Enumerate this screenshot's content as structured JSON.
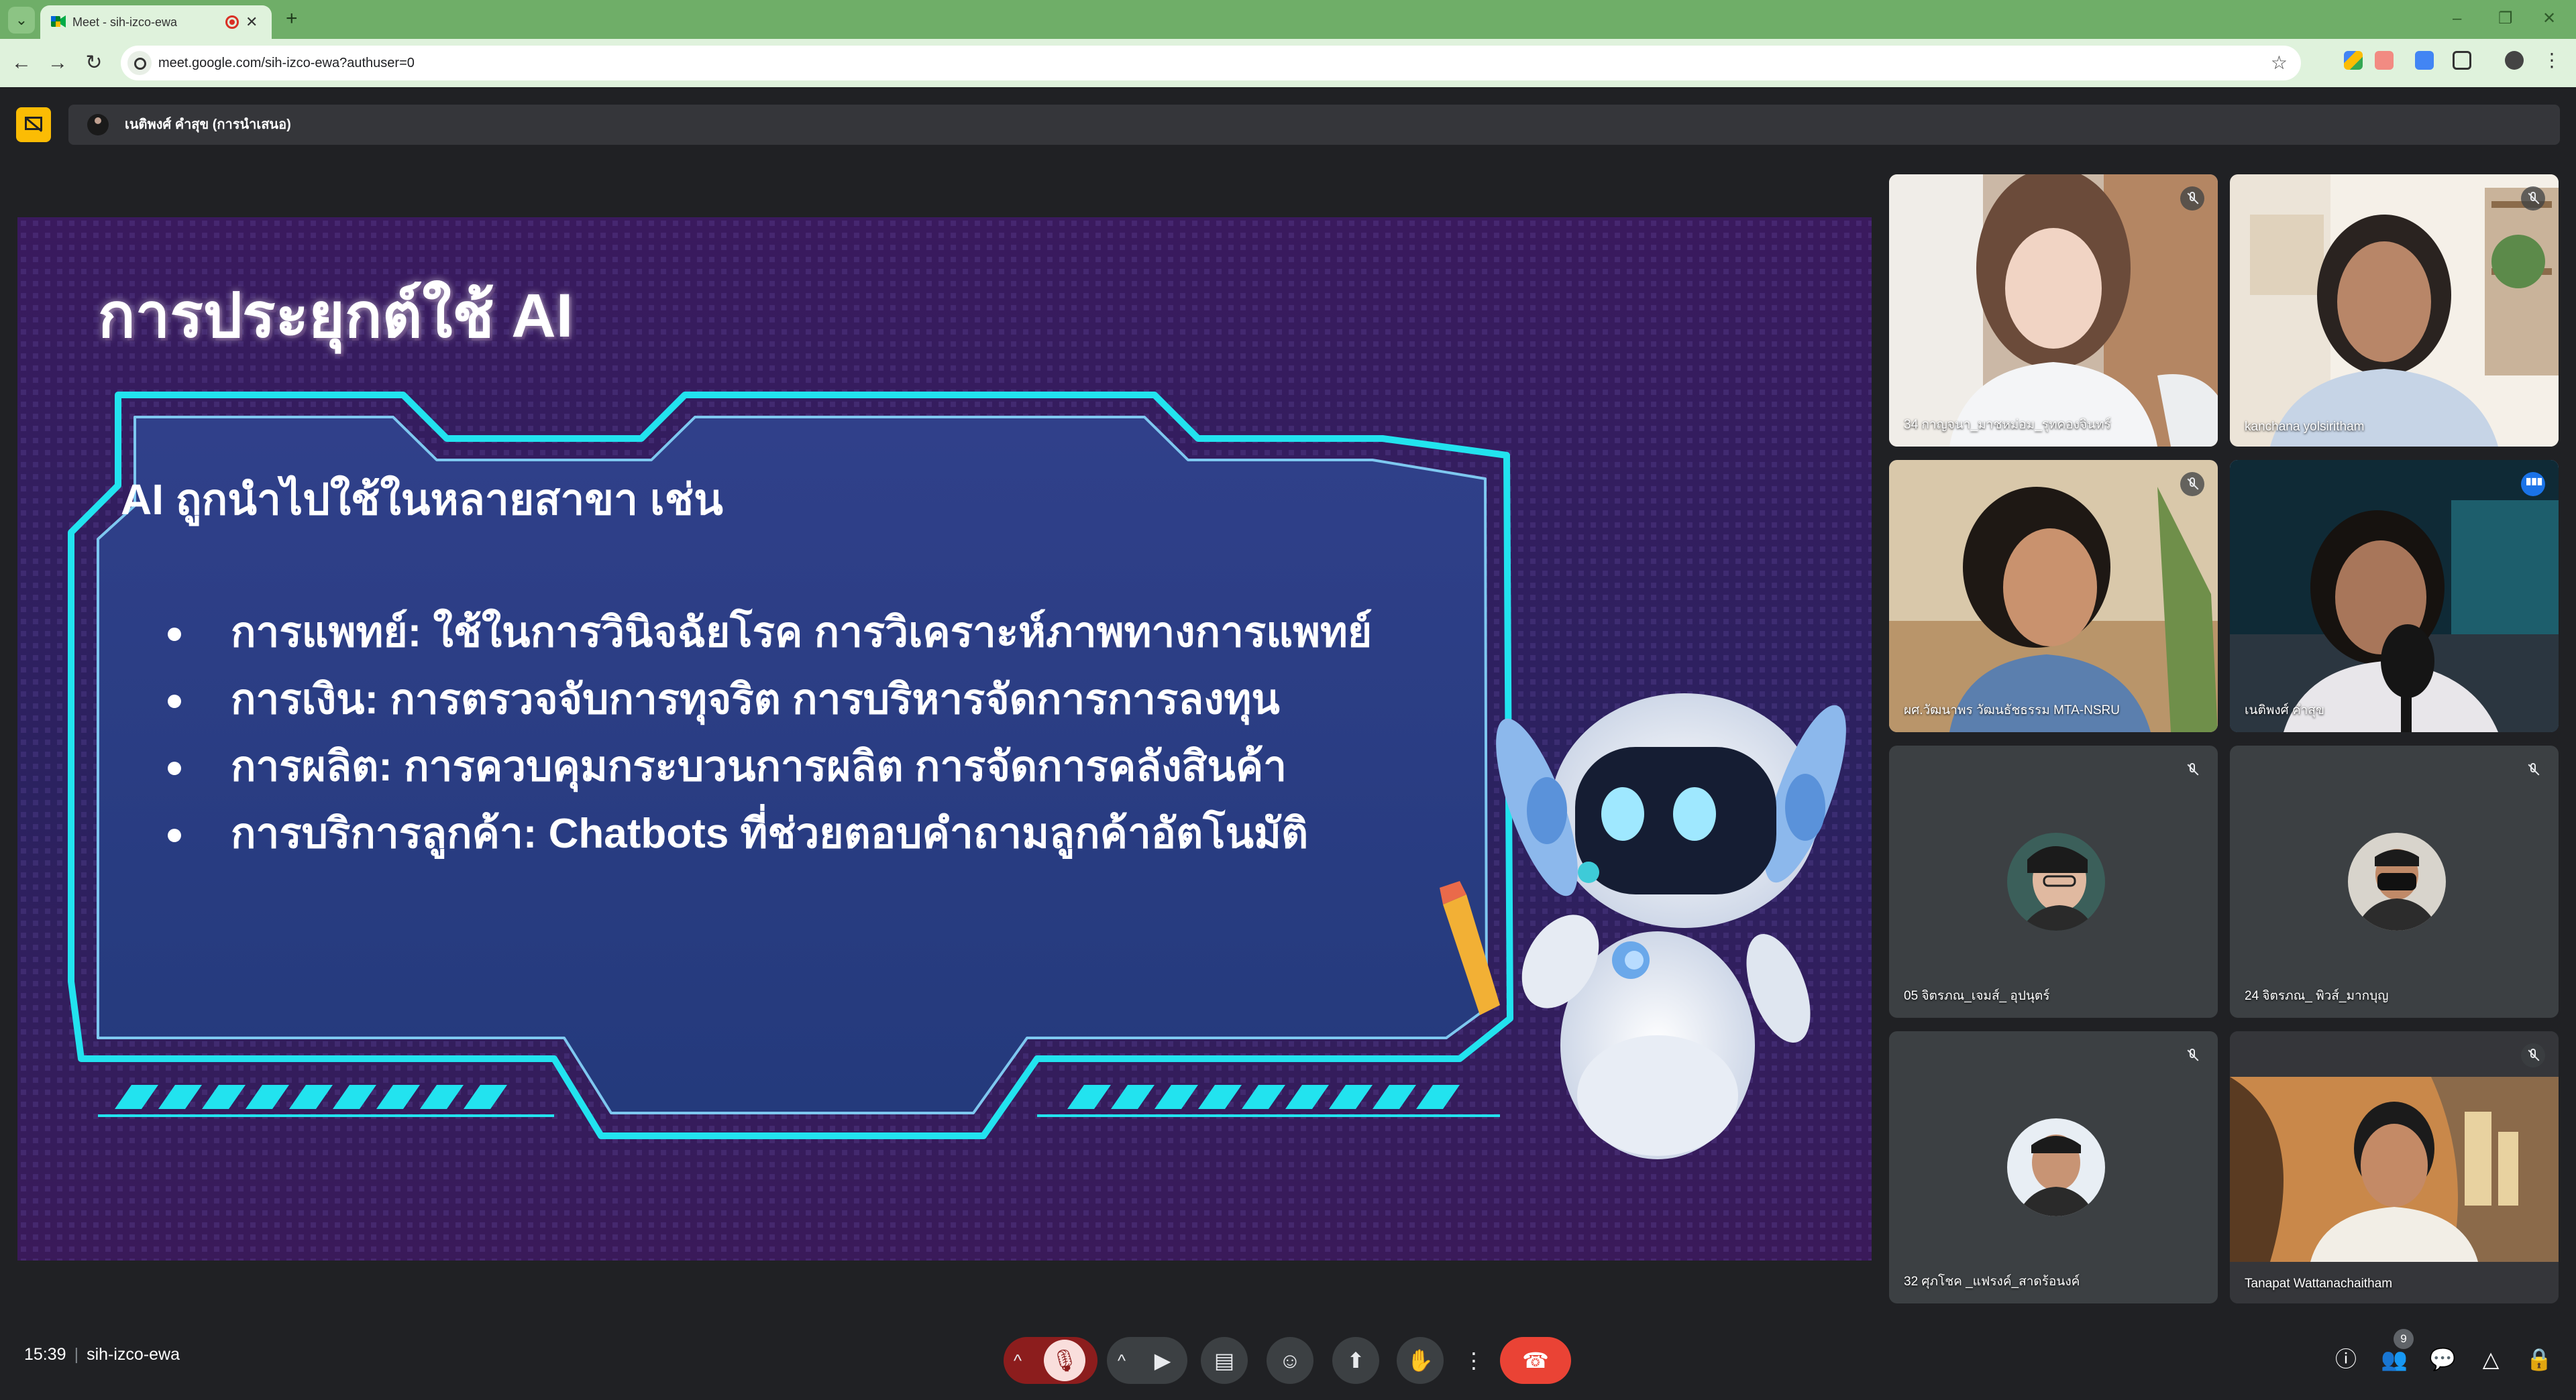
{
  "browser": {
    "tab_title": "Meet - sih-izco-ewa",
    "close_glyph": "✕",
    "new_tab_glyph": "+",
    "url": "meet.google.com/sih-izco-ewa?authuser=0",
    "window_controls": {
      "minimize": "–",
      "restore": "❐",
      "close": "✕"
    }
  },
  "meet": {
    "presenter_label": "เนติพงศ์ คำสุข (การนำเสนอ)",
    "meeting_code": "sih-izco-ewa",
    "time": "15:39",
    "participant_count": "9"
  },
  "slide": {
    "title": "การประยุกต์ใช้ AI",
    "subtitle": "AI ถูกนำไปใช้ในหลายสาขา เช่น",
    "bullets": [
      "การแพทย์: ใช้ในการวินิจฉัยโรค การวิเคราะห์ภาพทางการแพทย์",
      "การเงิน: การตรวจจับการทุจริต การบริหารจัดการการลงทุน",
      "การผลิต: การควบคุมกระบวนการผลิต การจัดการคลังสินค้า",
      "การบริการลูกค้า: Chatbots ที่ช่วยตอบคำถามลูกค้าอัตโนมัติ"
    ],
    "colors": {
      "background_top": "#3a1a5e",
      "background_bottom": "#14214f",
      "frame": "#22e3ef",
      "panel": "#2a3f86"
    }
  },
  "participants": [
    {
      "name": "34 กาญจนา_มาชหม่อม_รุทคองจินทร์",
      "status": "muted"
    },
    {
      "name": "kanchana yolsiritham",
      "status": "muted"
    },
    {
      "name": "ผศ.วัฒนาพร วัฒนธัชธรรม MTA-NSRU",
      "status": "muted"
    },
    {
      "name": "เนติพงศ์ คำสุข",
      "status": "speaking"
    },
    {
      "name": "05 จิตรภณ_เจมส์_ อุปนุตร์",
      "status": "muted"
    },
    {
      "name": "24 จิตรภณ_ พิวส์_มากบุญ",
      "status": "muted"
    },
    {
      "name": "32 ศุภโชค _แฟรงค์_สาดร้อนงค์",
      "status": "muted"
    },
    {
      "name": "Tanapat Wattanachaitham",
      "status": "muted"
    }
  ],
  "controls": {
    "raise_caret": "^",
    "mic_off": "🎙",
    "camera": "▶",
    "captions": "▤",
    "emoji": "☺",
    "present": "⬆",
    "hand": "✋",
    "more": "⋮",
    "leave": "☎",
    "info": "ⓘ",
    "people": "👥",
    "chat": "💬",
    "activities": "△",
    "host": "🔒"
  }
}
